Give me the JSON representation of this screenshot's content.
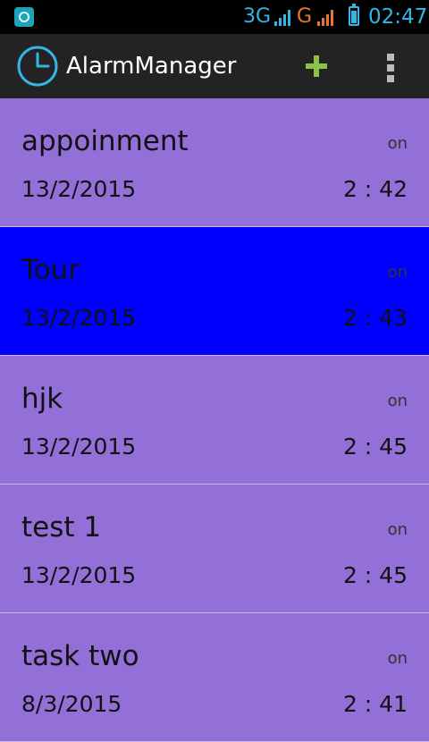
{
  "status_bar": {
    "network_3g": "3G",
    "network_g": "G",
    "time": "02:47",
    "notification_icon": "sync-icon",
    "colors": {
      "primary": "#33b5e5",
      "secondary": "#e8762b"
    }
  },
  "action_bar": {
    "title": "AlarmManager",
    "app_icon": "clock-icon",
    "add_icon": "plus-icon",
    "overflow_icon": "overflow-menu-icon",
    "colors": {
      "background": "#232323",
      "add": "#8bc34a"
    }
  },
  "alarms": [
    {
      "title": "appoinment",
      "status": "on",
      "date": "13/2/2015",
      "time": "2 : 42",
      "selected": false
    },
    {
      "title": "Tour",
      "status": "on",
      "date": "13/2/2015",
      "time": "2 : 43",
      "selected": true
    },
    {
      "title": "hjk",
      "status": "on",
      "date": "13/2/2015",
      "time": "2 : 45",
      "selected": false
    },
    {
      "title": "test 1",
      "status": "on",
      "date": "13/2/2015",
      "time": "2 : 45",
      "selected": false
    },
    {
      "title": "task two",
      "status": "on",
      "date": "8/3/2015",
      "time": "2 : 41",
      "selected": false
    }
  ],
  "colors": {
    "row_background": "#9370d8",
    "row_selected": "#0000ff"
  }
}
